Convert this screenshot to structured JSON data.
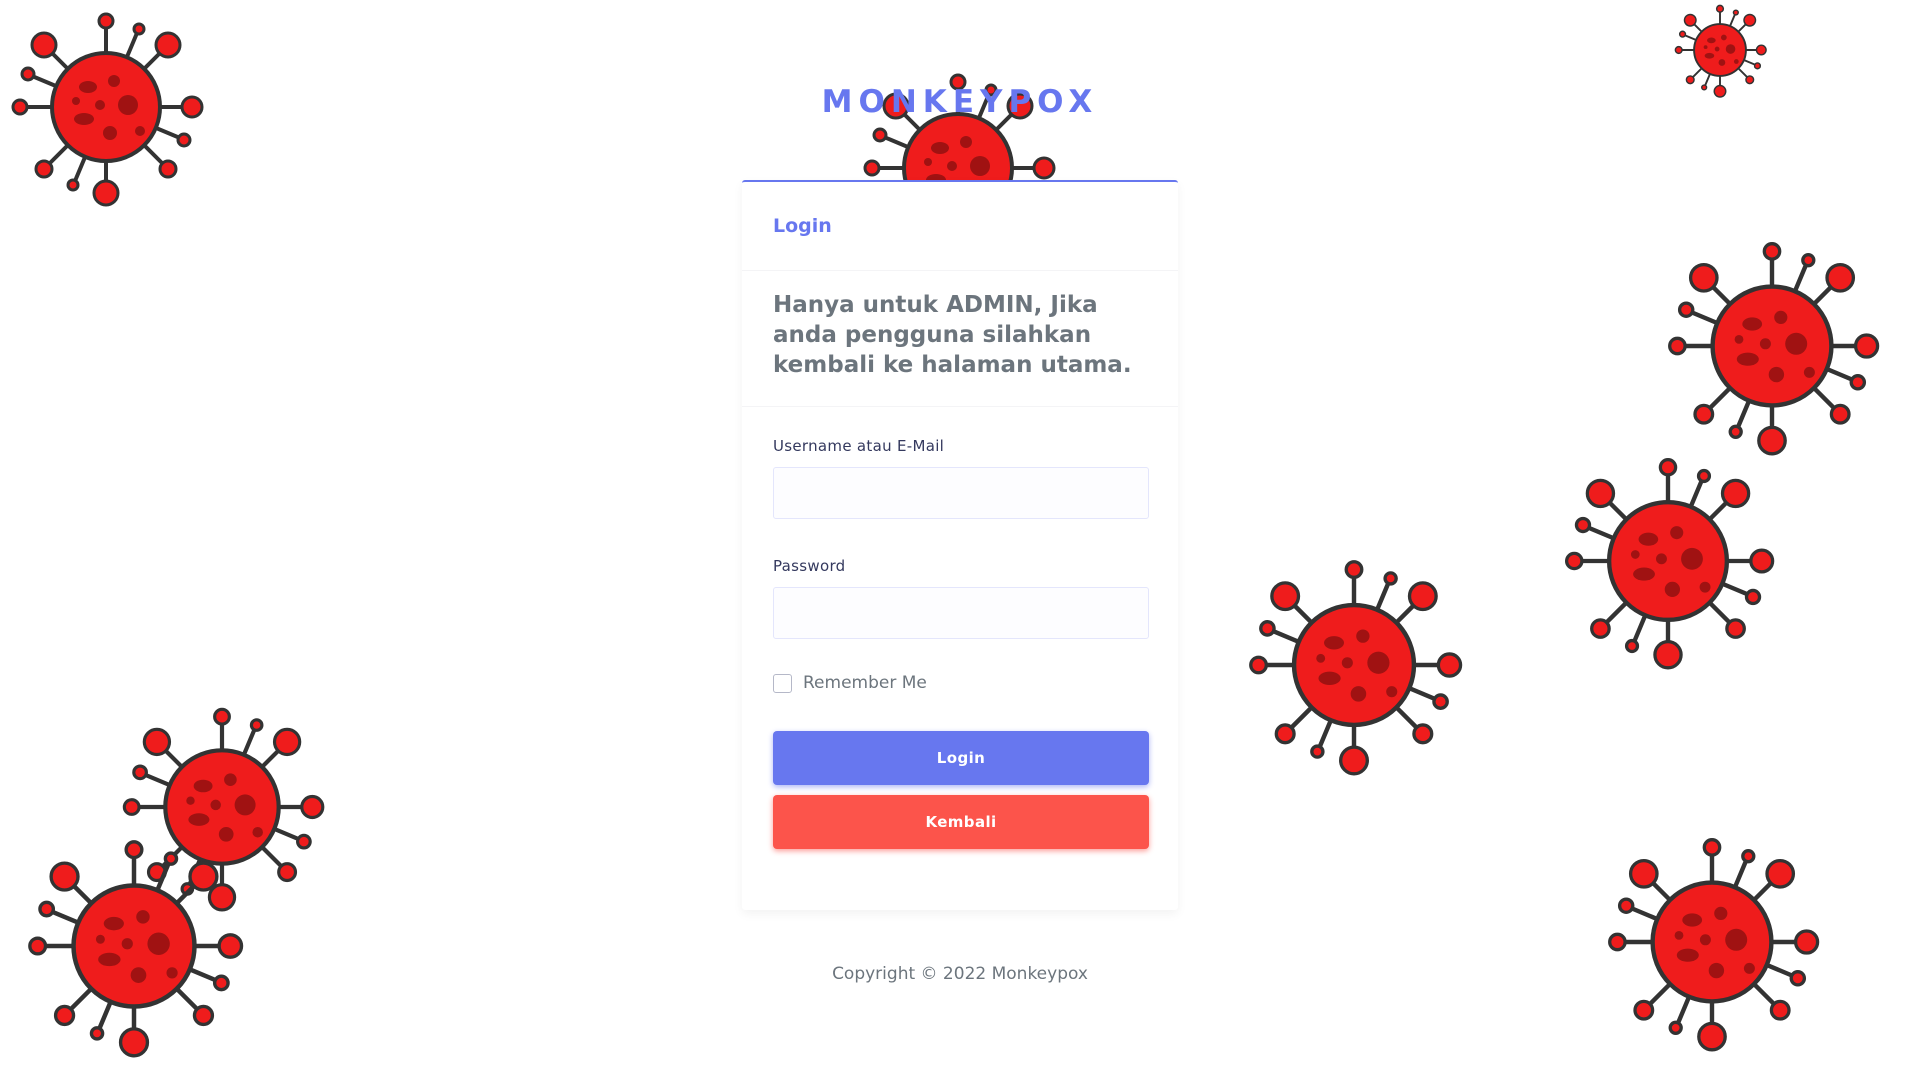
{
  "brand": {
    "title": "MONKEYPOX"
  },
  "card": {
    "header_title": "Login",
    "notice": "Hanya untuk ADMIN, Jika anda pengguna silahkan kembali ke halaman utama."
  },
  "form": {
    "username_label": "Username atau E-Mail",
    "username_value": "",
    "password_label": "Password",
    "password_value": "",
    "remember_label": "Remember Me",
    "remember_checked": false,
    "login_button": "Login",
    "back_button": "Kembali"
  },
  "footer": {
    "copyright": "Copyright © 2022 Monkeypox"
  },
  "colors": {
    "primary": "#6777ef",
    "danger": "#fc544b",
    "virus_red": "#ef1c1c",
    "virus_outline": "#333333"
  },
  "decorations": {
    "icon": "monkeypox-virus-icon"
  }
}
